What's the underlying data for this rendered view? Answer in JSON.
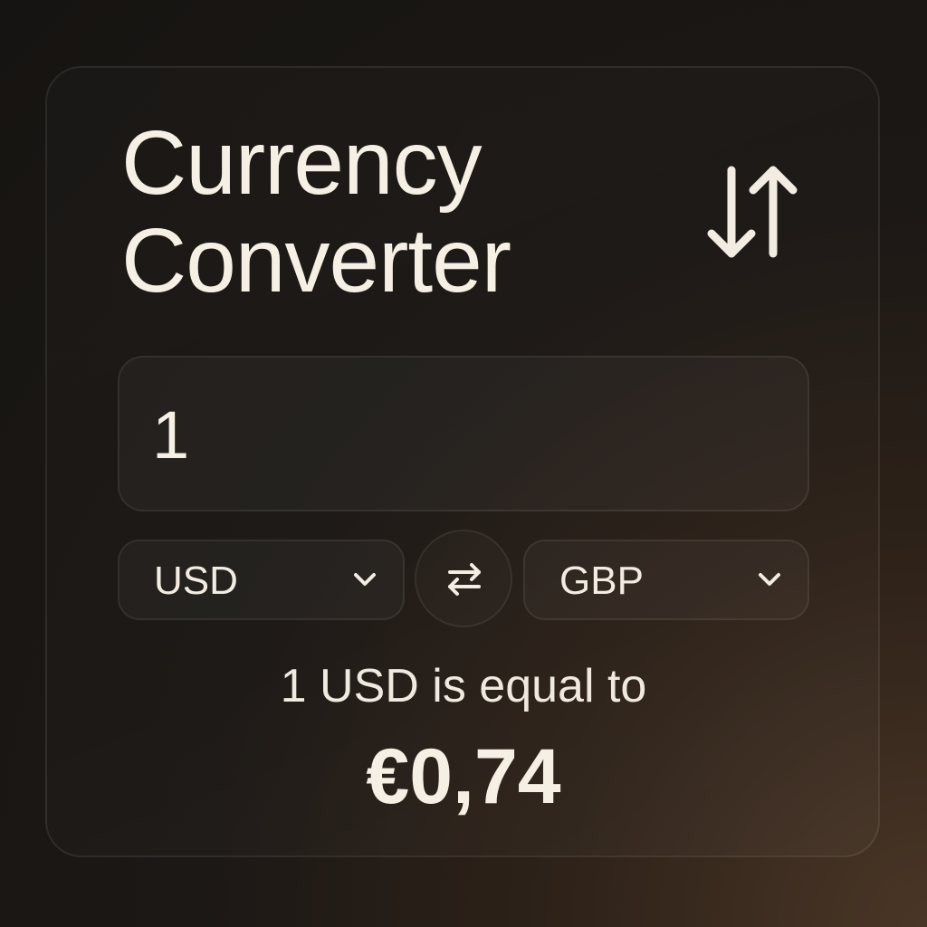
{
  "app": {
    "title_line1": "Currency",
    "title_line2": "Converter"
  },
  "amount": {
    "value": "1"
  },
  "from_currency": {
    "selected": "USD"
  },
  "to_currency": {
    "selected": "GBP"
  },
  "result": {
    "description": "1 USD is equal to",
    "value": "€0,74"
  },
  "icons": {
    "header": "sort-arrows-icon",
    "swap": "swap-arrows-icon",
    "dropdown": "chevron-down-icon"
  },
  "colors": {
    "text": "#f6efe4",
    "background": "#161412",
    "accent_glow": "#4a3626"
  }
}
